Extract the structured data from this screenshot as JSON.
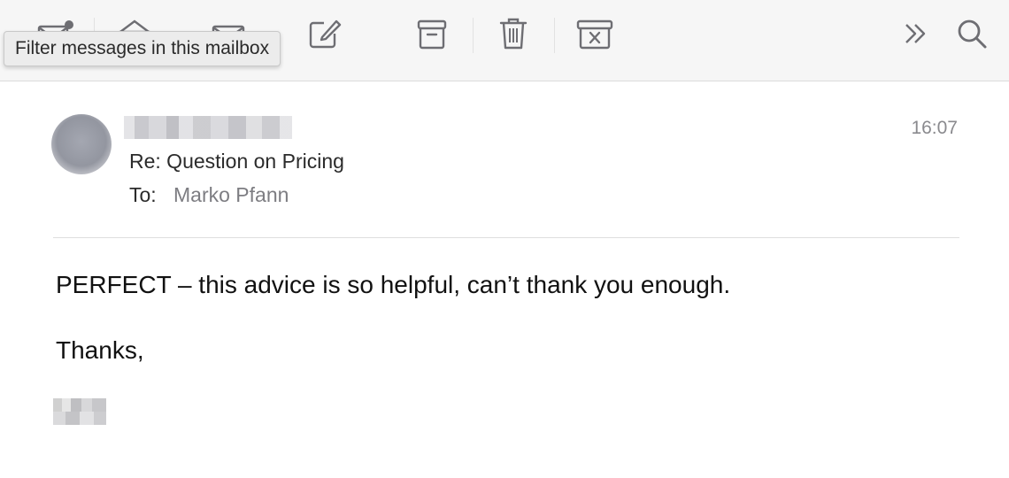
{
  "toolbar": {
    "icons": [
      "get-mail-icon",
      "reply-all-icon",
      "new-message-icon",
      "compose-icon",
      "archive-icon",
      "trash-icon",
      "junk-icon",
      "more-chevron-icon",
      "search-icon"
    ],
    "tooltip": "Filter messages in this mailbox",
    "icon_color": "#6e6e73"
  },
  "message": {
    "subject": "Re: Question on Pricing",
    "to_label": "To:",
    "to_name": "Marko Pfann",
    "time": "16:07"
  },
  "body": {
    "line1": "PERFECT – this advice is so helpful, can’t thank you enough.",
    "line2": "Thanks,"
  },
  "colors": {
    "toolbar_bg": "#f6f6f6",
    "muted_text": "#7d7d82",
    "time_text": "#8a8a8e"
  }
}
